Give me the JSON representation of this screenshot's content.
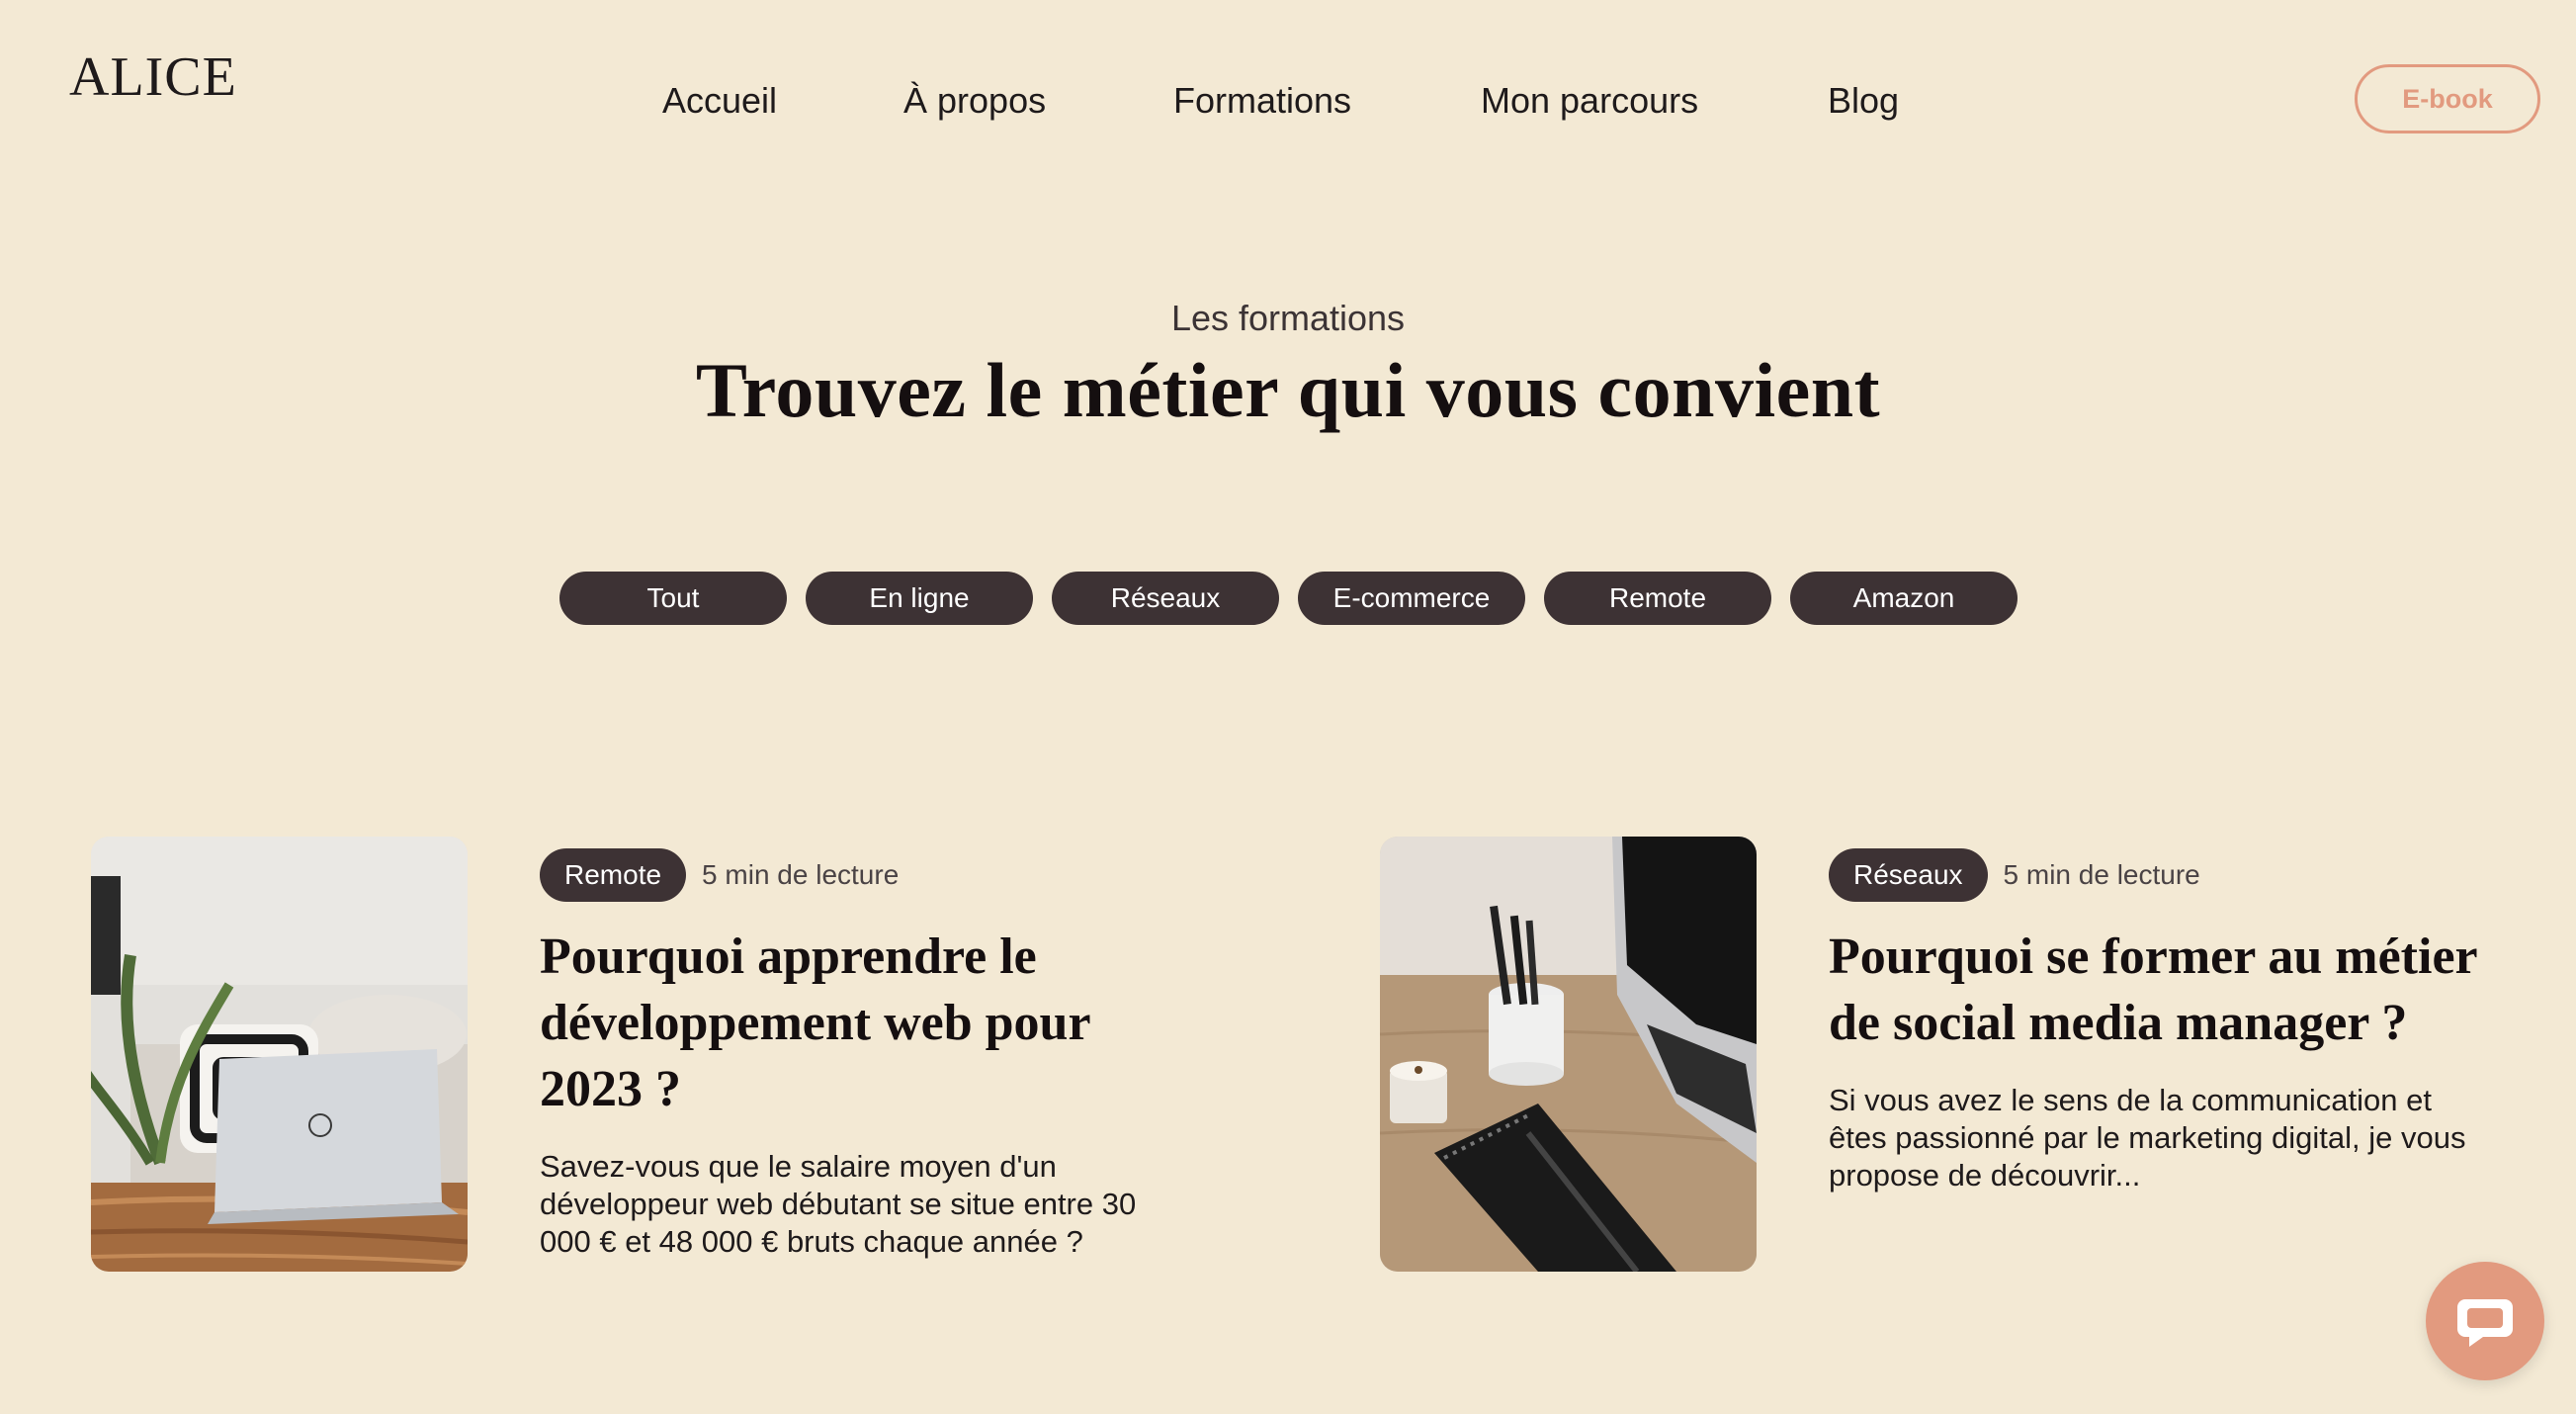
{
  "brand": {
    "logo": "ALICE"
  },
  "nav": {
    "items": [
      "Accueil",
      "À propos",
      "Formations",
      "Mon parcours",
      "Blog"
    ]
  },
  "header": {
    "ebook_label": "E-book"
  },
  "hero": {
    "eyebrow": "Les formations",
    "title": "Trouvez le métier qui vous convient"
  },
  "filters": [
    "Tout",
    "En ligne",
    "Réseaux",
    "E-commerce",
    "Remote",
    "Amazon"
  ],
  "articles": [
    {
      "tag": "Remote",
      "read_time": "5 min de lecture",
      "title": "Pourquoi apprendre le développement web pour 2023 ?",
      "excerpt": "Savez-vous que le salaire moyen d'un développeur web débutant se situe entre 30 000 € et 48 000 € bruts chaque année ?"
    },
    {
      "tag": "Réseaux",
      "read_time": "5 min de lecture",
      "title": "Pourquoi se former au métier de social media manager ?",
      "excerpt": "Si vous avez le sens de la communication et êtes passionné par le marketing digital, je vous propose de découvrir..."
    }
  ],
  "colors": {
    "background": "#f3e9d4",
    "pill": "#3d3234",
    "accent": "#e29a7f",
    "heading": "#150f10"
  },
  "icons": {
    "chat": "chat-bubble-icon"
  }
}
